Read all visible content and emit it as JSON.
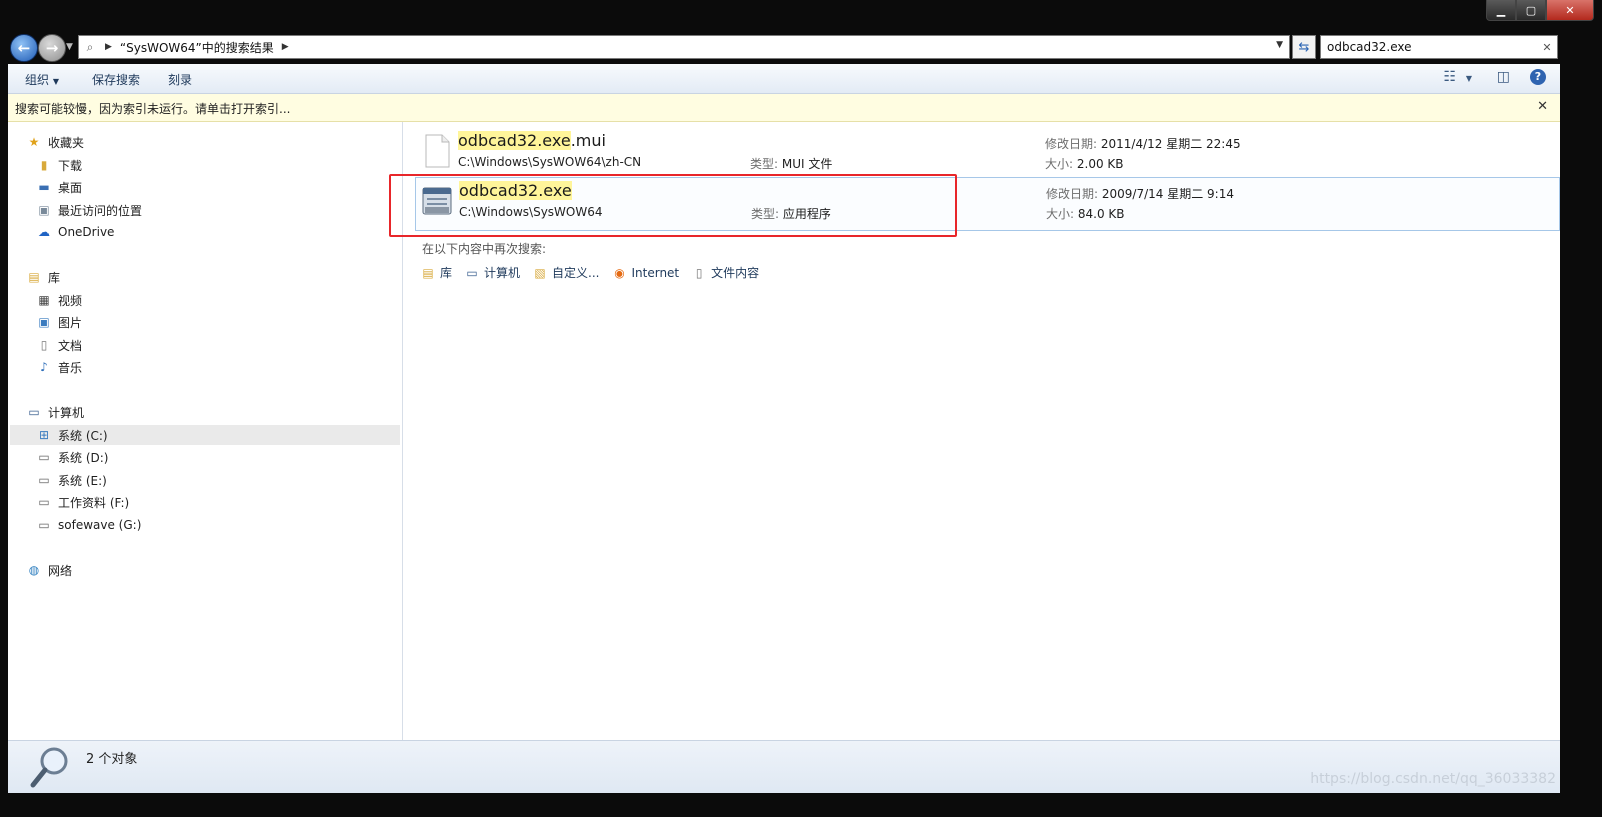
{
  "address": {
    "path_label": "“SysWOW64”中的搜索结果"
  },
  "search": {
    "query": "odbcad32.exe"
  },
  "toolbar": {
    "organize": "组织",
    "save_search": "保存搜索",
    "burn": "刻录"
  },
  "infobar": {
    "message": "搜索可能较慢，因为索引未运行。请单击打开索引..."
  },
  "nav": {
    "favorites": {
      "label": "收藏夹",
      "items": [
        {
          "label": "下载",
          "icon": "download-folder-icon"
        },
        {
          "label": "桌面",
          "icon": "desktop-icon"
        },
        {
          "label": "最近访问的位置",
          "icon": "recent-places-icon"
        },
        {
          "label": "OneDrive",
          "icon": "onedrive-icon"
        }
      ]
    },
    "libraries": {
      "label": "库",
      "items": [
        {
          "label": "视频",
          "icon": "video-icon"
        },
        {
          "label": "图片",
          "icon": "pictures-icon"
        },
        {
          "label": "文档",
          "icon": "documents-icon"
        },
        {
          "label": "音乐",
          "icon": "music-icon"
        }
      ]
    },
    "computer": {
      "label": "计算机",
      "items": [
        {
          "label": "系统 (C:)",
          "icon": "system-drive-icon"
        },
        {
          "label": "系统 (D:)",
          "icon": "drive-icon"
        },
        {
          "label": "系统 (E:)",
          "icon": "drive-icon"
        },
        {
          "label": "工作资料 (F:)",
          "icon": "drive-icon"
        },
        {
          "label": "sofewave (G:)",
          "icon": "drive-icon"
        }
      ]
    },
    "network": {
      "label": "网络"
    }
  },
  "results": [
    {
      "name_hl": "odbcad32.exe",
      "name_rest": ".mui",
      "path": "C:\\Windows\\SysWOW64\\zh-CN",
      "type_label": "类型:",
      "type": "MUI 文件",
      "date_label": "修改日期:",
      "date": "2011/4/12 星期二 22:45",
      "size_label": "大小:",
      "size": "2.00 KB",
      "icon": "blank-file-icon"
    },
    {
      "name_hl": "odbcad32.exe",
      "name_rest": "",
      "path": "C:\\Windows\\SysWOW64",
      "type_label": "类型:",
      "type": "应用程序",
      "date_label": "修改日期:",
      "date": "2009/7/14 星期二 9:14",
      "size_label": "大小:",
      "size": "84.0 KB",
      "icon": "application-icon"
    }
  ],
  "search_again": {
    "label": "在以下内容中再次搜索:",
    "links": [
      {
        "label": "库",
        "icon": "library-icon"
      },
      {
        "label": "计算机",
        "icon": "computer-icon"
      },
      {
        "label": "自定义...",
        "icon": "custom-folder-icon"
      },
      {
        "label": "Internet",
        "icon": "internet-icon"
      },
      {
        "label": "文件内容",
        "icon": "file-contents-icon"
      }
    ]
  },
  "details": {
    "count": "2 个对象"
  },
  "watermark": "https://blog.csdn.net/qq_36033382",
  "colors": {
    "highlight_box": "#e8262a",
    "search_highlight": "#fff59a"
  }
}
